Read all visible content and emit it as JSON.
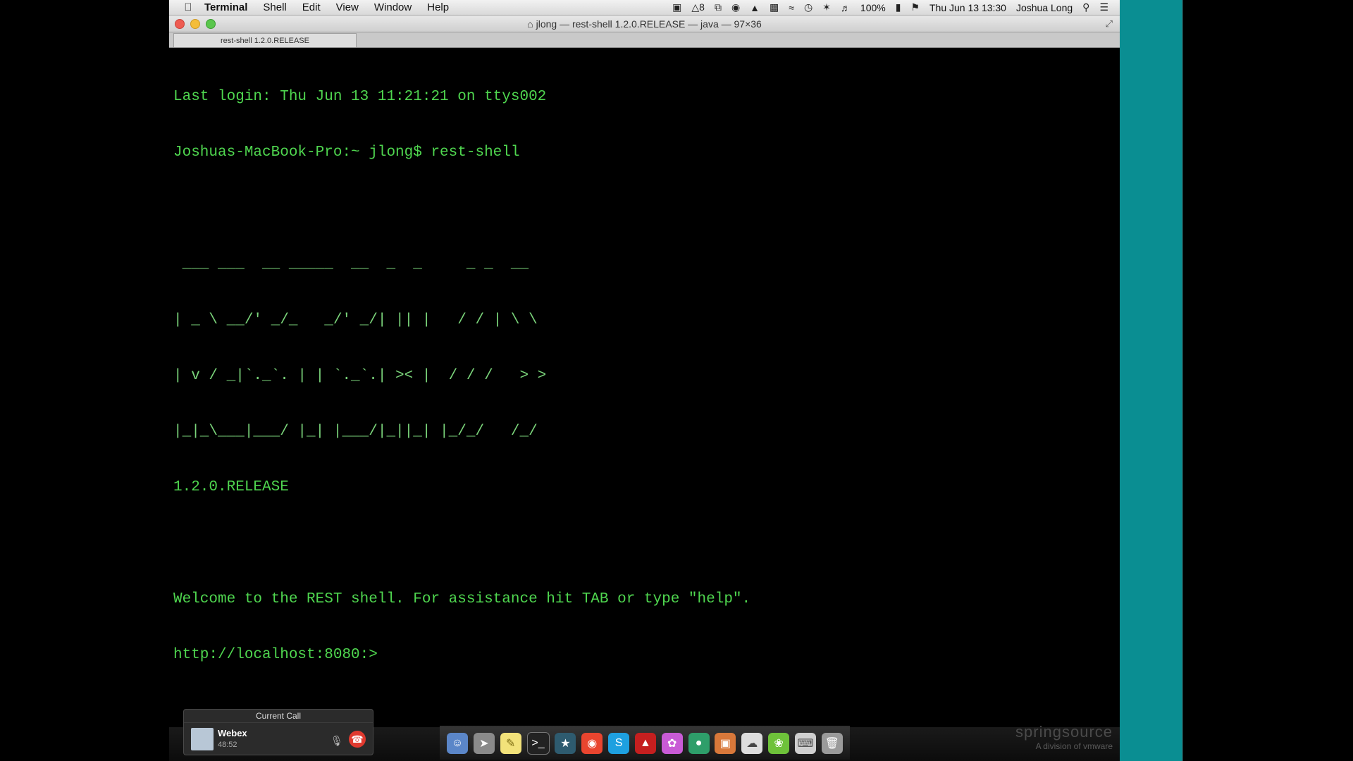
{
  "menubar": {
    "app_name": "Terminal",
    "menus": [
      "Shell",
      "Edit",
      "View",
      "Window",
      "Help"
    ],
    "status_badge": "8",
    "battery": "100%",
    "datetime": "Thu Jun 13  13:30",
    "user": "Joshua Long"
  },
  "window": {
    "title": "jlong — rest-shell 1.2.0.RELEASE — java — 97×36",
    "tab_label": "rest-shell 1.2.0.RELEASE"
  },
  "terminal": {
    "lines": [
      "Last login: Thu Jun 13 11:21:21 on ttys002",
      "Joshuas-MacBook-Pro:~ jlong$ rest-shell",
      ""
    ],
    "ascii_banner": [
      " ___ ___  __ _____  __  _  _     _ _  __",
      "| _ \\ __/' _/_   _/' _/| || |   / / | \\ \\",
      "| v / _|`._`. | | `._`.| >< |  / / /   > >",
      "|_|_\\___|___/ |_| |___/|_||_| |_/_/   /_/",
      "1.2.0.RELEASE"
    ],
    "welcome": "Welcome to the REST shell. For assistance hit TAB or type \"help\".",
    "prompt": "http://localhost:8080:>"
  },
  "call": {
    "header": "Current Call",
    "name": "Webex",
    "duration": "48:52"
  },
  "dock": {
    "icons": [
      "finder-icon",
      "launchpad-icon",
      "notes-icon",
      "terminal-icon",
      "elephant-icon",
      "chrome-icon",
      "skype-icon",
      "acrobat-icon",
      "flower-icon",
      "globe-icon",
      "presentation-icon",
      "preview-icon",
      "leaf-icon",
      "keyboard-icon",
      "trash-icon"
    ]
  },
  "watermark": {
    "brand": "springsource",
    "subtitle": "A division of vmware"
  },
  "colors": {
    "terminal_green": "#4fd64f",
    "teal_band": "#0a8e92",
    "hangup_red": "#e03a2f"
  }
}
